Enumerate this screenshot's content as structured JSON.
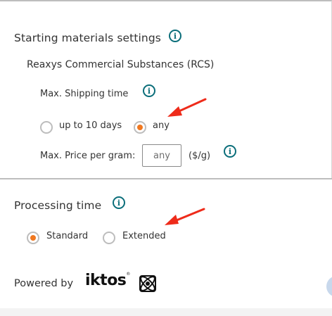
{
  "starting_materials": {
    "title": "Starting materials settings",
    "subtitle": "Reaxys Commercial Substances (RCS)",
    "shipping": {
      "label": "Max. Shipping time",
      "options": [
        {
          "label": "up to 10 days",
          "selected": false
        },
        {
          "label": "any",
          "selected": true
        }
      ]
    },
    "price": {
      "label": "Max. Price per gram:",
      "placeholder": "any",
      "unit": "($/g)"
    }
  },
  "processing_time": {
    "title": "Processing time",
    "options": [
      {
        "label": "Standard",
        "selected": true
      },
      {
        "label": "Extended",
        "selected": false
      }
    ]
  },
  "footer": {
    "powered_by": "Powered by",
    "brand": "iktos",
    "trademark": "®"
  },
  "icons": {
    "info": "i"
  },
  "colors": {
    "accent": "#f07820",
    "info": "#0b6e7a",
    "arrow": "#ee2b1a"
  }
}
